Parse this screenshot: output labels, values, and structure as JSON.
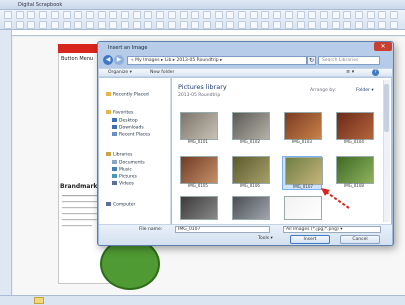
{
  "app": {
    "title": "Digital Scrapbook",
    "status_icon": "folder-icon"
  },
  "document": {
    "page_label": "Button Menu",
    "heading": "Brandmark",
    "green_shape_color": "#4f9a32",
    "header_color": "#d9261c"
  },
  "dialog": {
    "title": "Insert an Image",
    "close": "✕",
    "address": "« My Images ▸ Lib ▸ 2013-05 Roundtrip ▸",
    "search_placeholder": "Search Libraries",
    "toolbar": {
      "organize": "Organize ▾",
      "new_folder": "New folder",
      "view": "≡ ▾",
      "help": "?"
    },
    "nav_items": [
      {
        "label": "Recently Placed",
        "icon": "star-icon",
        "color": "#e9b64a"
      },
      {
        "label": "Favorites",
        "icon": "star-icon",
        "color": "#e9b64a"
      },
      {
        "label": "Desktop",
        "icon": "desktop-icon",
        "color": "#3d6fb4"
      },
      {
        "label": "Downloads",
        "icon": "download-icon",
        "color": "#3d6fb4"
      },
      {
        "label": "Recent Places",
        "icon": "clock-icon",
        "color": "#6a8fc4"
      },
      {
        "label": "Libraries",
        "icon": "library-icon",
        "color": "#c9a63d"
      },
      {
        "label": "Documents",
        "icon": "document-icon",
        "color": "#8aa5c8"
      },
      {
        "label": "Music",
        "icon": "music-icon",
        "color": "#4a7cc0"
      },
      {
        "label": "Pictures",
        "icon": "picture-icon",
        "color": "#4a9ac0"
      },
      {
        "label": "Videos",
        "icon": "video-icon",
        "color": "#5b6f9a"
      },
      {
        "label": "Computer",
        "icon": "computer-icon",
        "color": "#5b6f9a"
      }
    ],
    "library": {
      "title": "Pictures library",
      "subtitle": "2013-05 Roundtrip",
      "arrange_label": "Arrange by:",
      "arrange_value": "Folder ▾"
    },
    "thumbnails": [
      {
        "caption": "IMG_0101",
        "c1": "#7a746a",
        "c2": "#c9c3b6",
        "selected": false
      },
      {
        "caption": "IMG_0102",
        "c1": "#5a5a55",
        "c2": "#b6b2a8",
        "selected": false
      },
      {
        "caption": "IMG_0103",
        "c1": "#7a3b22",
        "c2": "#c9824a",
        "selected": false
      },
      {
        "caption": "IMG_0104",
        "c1": "#6b2a1a",
        "c2": "#b5643c",
        "selected": false
      },
      {
        "caption": "IMG_0105",
        "c1": "#6f3c24",
        "c2": "#c6906a",
        "selected": false
      },
      {
        "caption": "IMG_0106",
        "c1": "#5c5a2c",
        "c2": "#a7a06a",
        "selected": false
      },
      {
        "caption": "IMG_0107",
        "c1": "#6e7f45",
        "c2": "#c7b47a",
        "selected": true
      },
      {
        "caption": "IMG_0108",
        "c1": "#3e6a25",
        "c2": "#8fb25e",
        "selected": false
      },
      {
        "caption": "",
        "c1": "#3a3a3a",
        "c2": "#8a8a8a",
        "selected": false
      },
      {
        "caption": "",
        "c1": "#4b4e55",
        "c2": "#a1a5ad",
        "selected": false
      },
      {
        "caption": "",
        "c1": "#f2f2f2",
        "c2": "#ffffff",
        "selected": false
      }
    ],
    "filename_label": "File name:",
    "filename_value": "IMG_0107",
    "filetype_value": "All Images (*.jpg;*.png) ▾",
    "tools": "Tools ▾",
    "insert": "Insert",
    "cancel": "Cancel",
    "arrow_color": "#d8241c"
  }
}
